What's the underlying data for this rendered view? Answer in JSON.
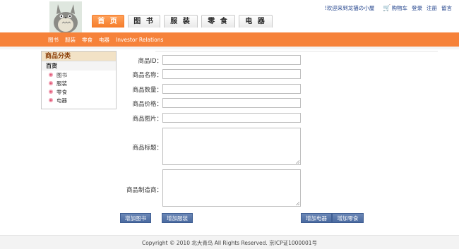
{
  "header": {
    "nav_tabs": [
      "首 页",
      "图 书",
      "服 装",
      "零 食",
      "电 器"
    ],
    "top_links": {
      "welcome": "!欢迎来到龙猫の小屋",
      "cart": "购物车",
      "login": "登录",
      "register": "注册",
      "message": "留言"
    }
  },
  "subnav": [
    "图书",
    "服装",
    "零食",
    "电器",
    "Investor Relations"
  ],
  "sidebar": {
    "title": "商品分类",
    "group": "百货",
    "items": [
      "图书",
      "服装",
      "零食",
      "电器"
    ]
  },
  "form": {
    "fields": {
      "id": "商品ID：",
      "name": "商品名称：",
      "quantity": "商品数量：",
      "price": "商品价格：",
      "image": "商品图片：",
      "description": "商品标题：",
      "manufacturer": "商品制造商："
    },
    "buttons": {
      "add_books": "增加图书",
      "add_clothing": "增加服装",
      "add_appliance": "增加电器",
      "add_snacks": "增加零食"
    }
  },
  "footer": {
    "text": "Copyright © 2010 北大青鸟 All Rights Reserved. 京ICP证1000001号"
  },
  "colors": {
    "accent_orange": "#f6823a",
    "button_blue": "#4a6aa0",
    "link_blue": "#1d3f8a",
    "bullet_pink": "#e05a78"
  }
}
